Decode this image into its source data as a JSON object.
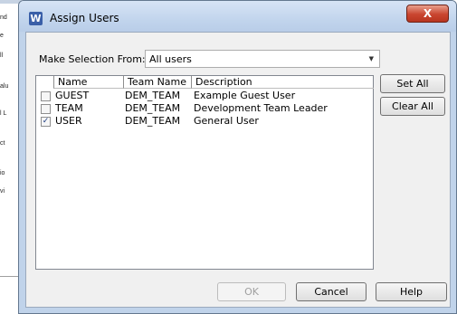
{
  "background_app": {
    "fragments": [
      "nd",
      "e",
      "ll",
      "alu",
      "l L",
      "ct",
      "io",
      "vi"
    ]
  },
  "dialog": {
    "app_icon": "W",
    "title": "Assign Users",
    "close_label": "X",
    "selection_label": "Make Selection From:",
    "selection_value": "All users",
    "columns": [
      "Name",
      "Team Name",
      "Description"
    ],
    "rows": [
      {
        "checked": false,
        "name": "GUEST",
        "team": "DEM_TEAM",
        "description": "Example Guest User"
      },
      {
        "checked": false,
        "name": "TEAM",
        "team": "DEM_TEAM",
        "description": "Development Team Leader"
      },
      {
        "checked": true,
        "name": "USER",
        "team": "DEM_TEAM",
        "description": "General User"
      }
    ],
    "set_all_label": "Set All",
    "clear_all_label": "Clear All",
    "ok_label": "OK",
    "cancel_label": "Cancel",
    "help_label": "Help"
  }
}
